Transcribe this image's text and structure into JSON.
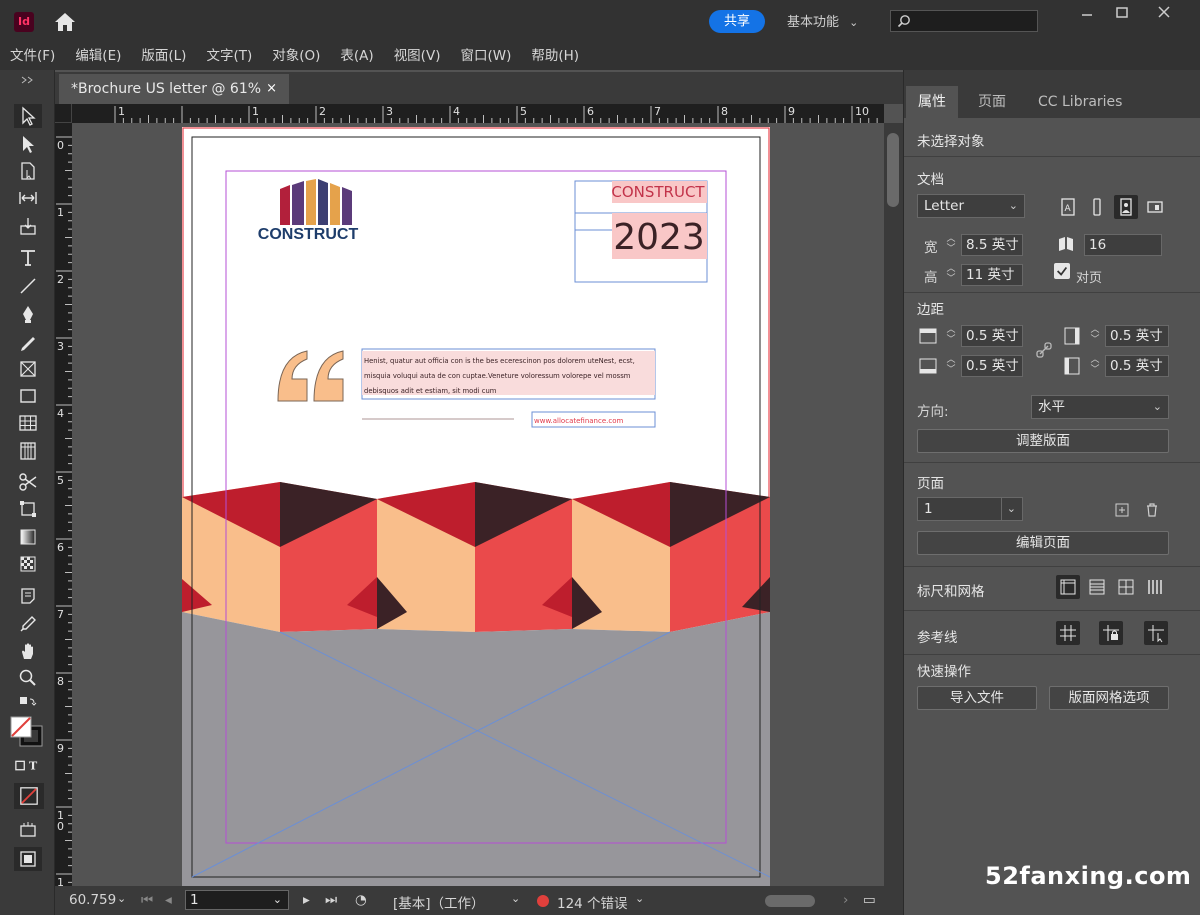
{
  "app": {
    "logo_text": "Id",
    "share_label": "共享",
    "workspace_label": "基本功能",
    "colors": {
      "accent": "#1473e6",
      "bg_dark": "#323232",
      "bg_panel": "#535353"
    }
  },
  "menu": [
    "文件(F)",
    "编辑(E)",
    "版面(L)",
    "文字(T)",
    "对象(O)",
    "表(A)",
    "视图(V)",
    "窗口(W)",
    "帮助(H)"
  ],
  "document": {
    "tab_title": "*Brochure US letter @ 61%",
    "close_glyph": "×"
  },
  "ruler": {
    "h_labels": [
      "1",
      "1",
      "2",
      "3",
      "4",
      "5",
      "6",
      "7",
      "8",
      "9",
      "10"
    ],
    "v_labels": [
      "0",
      "1",
      "2",
      "3",
      "4",
      "5",
      "6",
      "7",
      "8",
      "9",
      "1",
      "0",
      "1"
    ]
  },
  "page": {
    "logo_text": "CONSTRUCT",
    "heading": "CONSTRUCT",
    "year": "2023",
    "quote_lines": [
      "Henist, quatur aut officia con is the bes ecerescinon pos dolorem uteNest, ecst,",
      "misquia voluqui auta de con cuptae.Veneture voloressum volorepe vel mossm",
      "debisquos adit et estiam, sit modi cum"
    ],
    "website": "www.allocatefinance.com"
  },
  "status": {
    "zoom": "60.759",
    "page": "1",
    "mode": "[基本]（工作）",
    "errors": "124 个错误"
  },
  "panel": {
    "tabs": [
      "属性",
      "页面",
      "CC Libraries"
    ],
    "no_selection": "未选择对象",
    "document_title": "文档",
    "page_size": "Letter",
    "width_label": "宽",
    "width": "8.5 英寸",
    "height_label": "高",
    "height": "11 英寸",
    "pages_count": "16",
    "facing_pages_label": "对页",
    "margins_title": "边距",
    "margin_top": "0.5 英寸",
    "margin_bottom": "0.5 英寸",
    "margin_left": "0.5 英寸",
    "margin_right": "0.5 英寸",
    "orientation_label": "方向:",
    "orientation": "水平",
    "adjust_layout": "调整版面",
    "page_title": "页面",
    "page_value": "1",
    "edit_page": "编辑页面",
    "rulers_grids": "标尺和网格",
    "guides": "参考线",
    "quick_actions": "快速操作",
    "import_file": "导入文件",
    "layout_grid_options": "版面网格选项"
  },
  "watermark": "52fanxing.com"
}
